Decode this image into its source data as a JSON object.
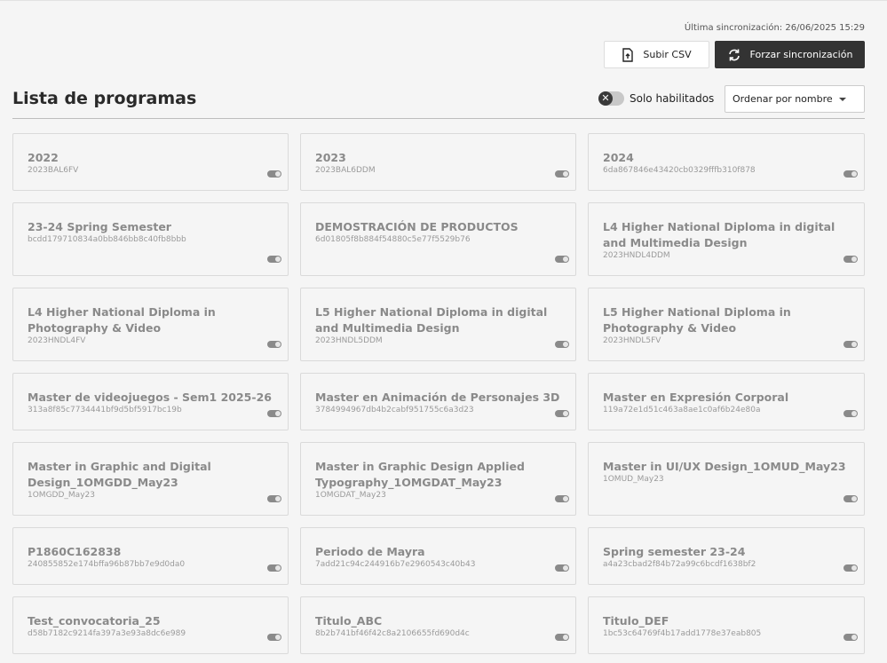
{
  "sync": {
    "last": "Última sincronización: 26/06/2025 15:29"
  },
  "toolbar": {
    "upload_label": "Subir CSV",
    "sync_label": "Forzar sincronización"
  },
  "header": {
    "title": "Lista de programas"
  },
  "filter": {
    "toggle_label": "Solo habilitados",
    "toggle_on": false
  },
  "sort": {
    "selected": "Ordenar por nombre"
  },
  "programs": [
    {
      "name": "2022",
      "code": "2023BAL6FV"
    },
    {
      "name": "2023",
      "code": "2023BAL6DDM"
    },
    {
      "name": "2024",
      "code": "6da867846e43420cb0329fffb310f878"
    },
    {
      "name": "23-24 Spring Semester",
      "code": "bcdd179710834a0bb846bb8c40fb8bbb"
    },
    {
      "name": "DEMOSTRACIÓN DE PRODUCTOS",
      "code": "6d01805f8b884f54880c5e77f5529b76"
    },
    {
      "name": "L4 Higher National Diploma in digital and Multimedia Design",
      "code": "2023HNDL4DDM"
    },
    {
      "name": "L4 Higher National Diploma in Photography & Video",
      "code": "2023HNDL4FV"
    },
    {
      "name": "L5 Higher National Diploma in digital and Multimedia Design",
      "code": "2023HNDL5DDM"
    },
    {
      "name": "L5 Higher National Diploma in Photography & Video",
      "code": "2023HNDL5FV"
    },
    {
      "name": "Master de videojuegos - Sem1 2025-26",
      "code": "313a8f85c7734441bf9d5bf5917bc19b"
    },
    {
      "name": "Master en Animación de Personajes 3D",
      "code": "3784994967db4b2cabf951755c6a3d23"
    },
    {
      "name": "Master en Expresión Corporal",
      "code": "119a72e1d51c463a8ae1c0af6b24e80a"
    },
    {
      "name": "Master in Graphic and Digital Design_1OMGDD_May23",
      "code": "1OMGDD_May23"
    },
    {
      "name": "Master in Graphic Design Applied Typography_1OMGDAT_May23",
      "code": "1OMGDAT_May23"
    },
    {
      "name": "Master in UI/UX Design_1OMUD_May23",
      "code": "1OMUD_May23"
    },
    {
      "name": "P1860C162838",
      "code": "240855852e174bffa96b87bb7e9d0da0"
    },
    {
      "name": "Periodo de Mayra",
      "code": "7add21c94c244916b7e2960543c40b43"
    },
    {
      "name": "Spring semester 23-24",
      "code": "a4a23cbad2f84b72a99c6bcdf1638bf2"
    },
    {
      "name": "Test_convocatoria_25",
      "code": "d58b7182c9214fa397a3e93a8dc6e989"
    },
    {
      "name": "Titulo_ABC",
      "code": "8b2b741bf46f42c8a2106655fd690d4c"
    },
    {
      "name": "Titulo_DEF",
      "code": "1bc53c64769f4b17add1778e37eab805"
    }
  ]
}
